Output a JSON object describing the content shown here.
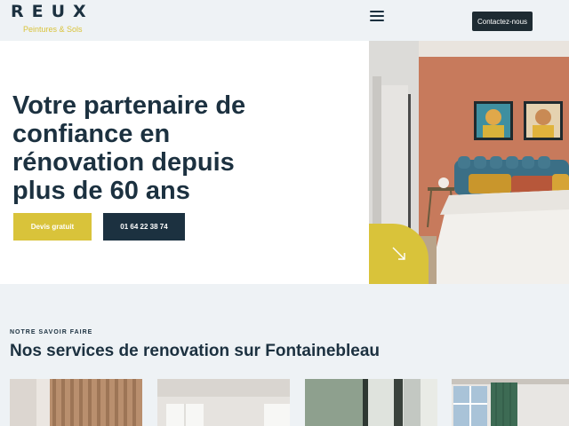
{
  "header": {
    "logo_text": "REUX",
    "logo_subtitle": "Peintures & Sols",
    "menu_icon": "hamburger-icon",
    "contact_label": "Contactez-nous"
  },
  "hero": {
    "title": "Votre partenaire de confiance en rénovation depuis plus de 60 ans",
    "quote_label": "Devis gratuit",
    "phone_label": "01 64 22 38 74",
    "arrow_icon": "arrow-down-right-icon"
  },
  "services": {
    "eyebrow": "NOTRE SAVOIR FAIRE",
    "title": "Nos services de renovation sur Fontainebleau"
  },
  "colors": {
    "accent": "#d9c33a",
    "primary": "#1c3140",
    "background": "#eef2f5"
  }
}
